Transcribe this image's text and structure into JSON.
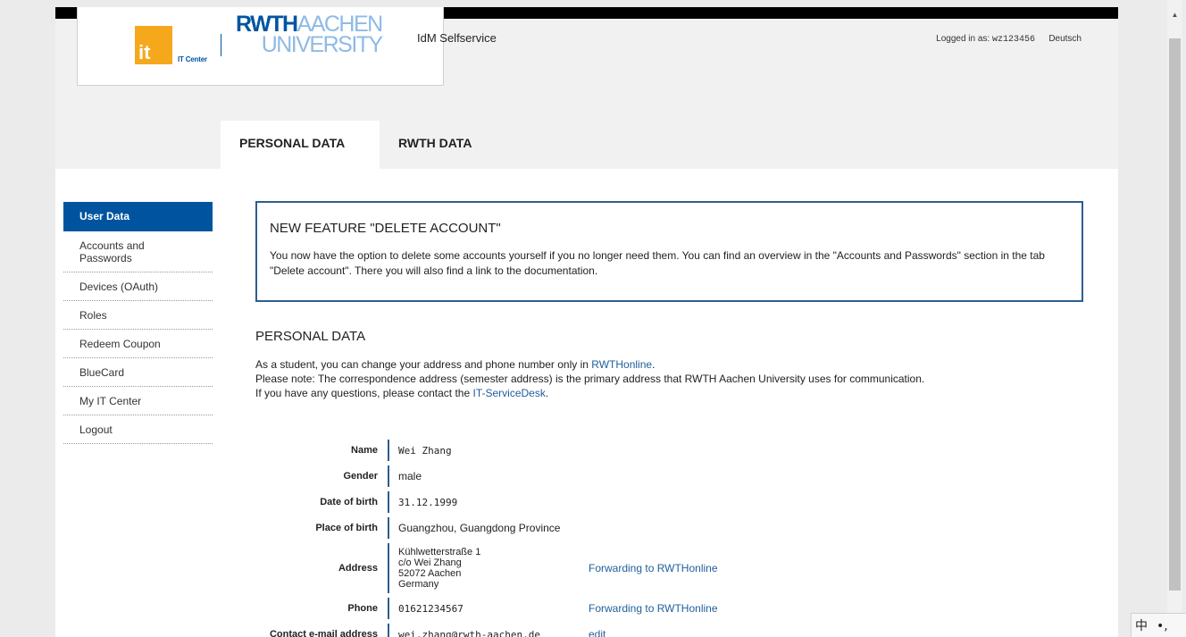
{
  "header": {
    "it_logo_text": "it",
    "it_center_label": "IT Center",
    "rwth_logo_line1_dark": "RWTH",
    "rwth_logo_line1_light": "AACHEN",
    "rwth_logo_line2": "UNIVERSITY",
    "app_title": "IdM Selfservice",
    "logged_in_label": "Logged in as:",
    "logged_in_user": "wz123456",
    "language_link": "Deutsch"
  },
  "tabs": [
    {
      "label": "PERSONAL DATA",
      "active": true
    },
    {
      "label": "RWTH DATA",
      "active": false
    }
  ],
  "sidebar": {
    "items": [
      {
        "label": "User Data",
        "active": true
      },
      {
        "label": "Accounts and Passwords"
      },
      {
        "label": "Devices (OAuth)"
      },
      {
        "label": "Roles"
      },
      {
        "label": "Redeem Coupon"
      },
      {
        "label": "BlueCard"
      },
      {
        "label": "My IT Center"
      },
      {
        "label": "Logout"
      }
    ]
  },
  "feature": {
    "title": "NEW FEATURE \"DELETE ACCOUNT\"",
    "text": "You now have the option to delete some accounts yourself if you no longer need them. You can find an overview in the \"Accounts and Passwords\" section in the tab \"Delete account\". There you will also find a link to the documentation."
  },
  "personal": {
    "title": "PERSONAL DATA",
    "line1_prefix": "As a student, you can change your address and phone number only in ",
    "line1_link": "RWTHonline",
    "line1_suffix": ".",
    "line2": "Please note: The correspondence address (semester address) is the primary address that RWTH Aachen University uses for communication.",
    "line3_prefix": "If you have any questions, please contact the ",
    "line3_link": "IT-ServiceDesk",
    "line3_suffix": "."
  },
  "fields": {
    "name": {
      "label": "Name",
      "value": "Wei Zhang"
    },
    "gender": {
      "label": "Gender",
      "value": "male"
    },
    "dob": {
      "label": "Date of birth",
      "value": "31.12.1999"
    },
    "pob": {
      "label": "Place of birth",
      "value": "Guangzhou, Guangdong Province"
    },
    "address": {
      "label": "Address",
      "lines": [
        "Kühlwetterstraße 1",
        "c/o Wei Zhang",
        "52072 Aachen",
        "Germany"
      ],
      "action": "Forwarding to RWTHonline"
    },
    "phone": {
      "label": "Phone",
      "value": "01621234567",
      "action": "Forwarding to RWTHonline"
    },
    "email": {
      "label": "Contact e-mail address",
      "value": "wei.zhang@rwth-aachen.de",
      "action": "edit"
    }
  },
  "ime": {
    "char": "中",
    "punct": "•,"
  },
  "colors": {
    "accent": "#00549f",
    "link": "#1f5e9c",
    "it_orange": "#f6a81d"
  }
}
